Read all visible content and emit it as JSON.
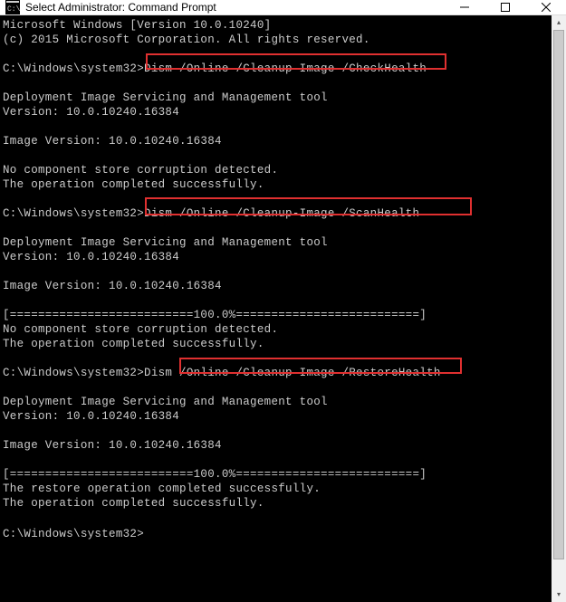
{
  "window": {
    "title": "Select Administrator: Command Prompt"
  },
  "terminal": {
    "line1": "Microsoft Windows [Version 10.0.10240]",
    "line2": "(c) 2015 Microsoft Corporation. All rights reserved.",
    "blank": "",
    "prompt1": "C:\\Windows\\system32>Dism /Online /Cleanup-Image /CheckHealth",
    "tool1a": "Deployment Image Servicing and Management tool",
    "tool1b": "Version: 10.0.10240.16384",
    "imgver1": "Image Version: 10.0.10240.16384",
    "res1a": "No component store corruption detected.",
    "res1b": "The operation completed successfully.",
    "prompt2": "C:\\Windows\\system32>Dism /Online /Cleanup-Image /ScanHealth",
    "tool2a": "Deployment Image Servicing and Management tool",
    "tool2b": "Version: 10.0.10240.16384",
    "imgver2": "Image Version: 10.0.10240.16384",
    "prog2": "[==========================100.0%==========================]",
    "res2a": "No component store corruption detected.",
    "res2b": "The operation completed successfully.",
    "prompt3": "C:\\Windows\\system32>Dism /Online /Cleanup-Image /RestoreHealth",
    "tool3a": "Deployment Image Servicing and Management tool",
    "tool3b": "Version: 10.0.10240.16384",
    "imgver3": "Image Version: 10.0.10240.16384",
    "prog3": "[==========================100.0%==========================]",
    "res3a": "The restore operation completed successfully.",
    "res3b": "The operation completed successfully.",
    "prompt4": "C:\\Windows\\system32>"
  },
  "highlights": {
    "h1_text": "/Online /Cleanup-Image /CheckHealth",
    "h2_text": "Dism /Online /Cleanup-Image /ScanHealth",
    "h3_text": "/Online /Cleanup-Image /RestoreHealth"
  }
}
